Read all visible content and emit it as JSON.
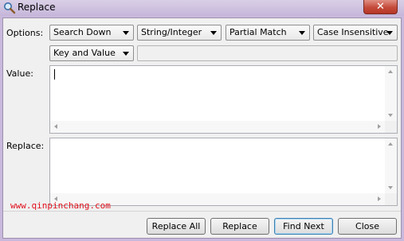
{
  "window": {
    "title": "Replace",
    "close_glyph": "✕"
  },
  "options": {
    "label": "Options:",
    "direction": "Search Down",
    "data_type": "String/Integer",
    "match": "Partial Match",
    "case": "Case Insensitive",
    "scope": "Key and Value"
  },
  "value": {
    "label": "Value:",
    "text": ""
  },
  "replace": {
    "label": "Replace:",
    "text": ""
  },
  "buttons": {
    "replace_all": "Replace All",
    "replace": "Replace",
    "find_next": "Find Next",
    "close": "Close"
  },
  "watermark": "www.qinpinchang.com",
  "colors": {
    "title_bar": "#c9b9dc",
    "close_button": "#c44b3b",
    "watermark": "#e0101b",
    "default_button_border": "#3c7fb1"
  }
}
